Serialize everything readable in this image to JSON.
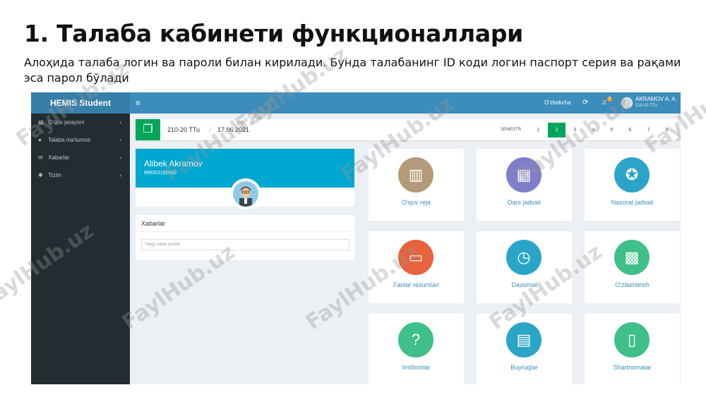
{
  "slide": {
    "title": "1. Талаба кабинети функционаллари",
    "subtitle": "Алоҳида талаба логин ва пароли билан кирилади. Бунда талабанинг ID коди логин паспорт серия ва рақами эса парол бўлади"
  },
  "topbar": {
    "logo": "HEMIS Student",
    "menu_glyph": "≡",
    "language": "O'zbekcha",
    "notifications_count": "0",
    "user_name": "AKRAMOV A. A.",
    "user_group": "210-20 TTu"
  },
  "sidebar": {
    "items": [
      {
        "label": "O'quv jarayoni",
        "icon": "book-icon"
      },
      {
        "label": "Talaba ma'lumoti",
        "icon": "user-icon"
      },
      {
        "label": "Xabarlar",
        "icon": "envelope-icon"
      },
      {
        "label": "Tizim",
        "icon": "gear-icon"
      }
    ]
  },
  "semester": {
    "group": "210-20 TTu",
    "separator": "/",
    "date": "17.06.2021",
    "label": "SEMESTR",
    "pages": [
      "1",
      "2",
      "3",
      "4",
      "5",
      "6",
      "7",
      "8"
    ],
    "active_page": "2"
  },
  "profile": {
    "name": "Alibek Akramov",
    "id": "999201100052"
  },
  "news": {
    "title": "Xabarlar",
    "placeholder": "Yangi xabar yozish"
  },
  "tiles": [
    {
      "label": "O'quv reja",
      "icon": "book-open-icon",
      "color": "#b39b7a"
    },
    {
      "label": "Dars jadvali",
      "icon": "calendar-icon",
      "color": "#7f7fc9"
    },
    {
      "label": "Nazorat jadvali",
      "icon": "medal-icon",
      "color": "#2aa5c7"
    },
    {
      "label": "Fanlar resurslari",
      "icon": "monitor-icon",
      "color": "#e6633d"
    },
    {
      "label": "Davomat",
      "icon": "clock-icon",
      "color": "#2aa5c7"
    },
    {
      "label": "O'zlashtirish",
      "icon": "calculator-icon",
      "color": "#3fbf8a"
    },
    {
      "label": "Imtihonlar",
      "icon": "question-icon",
      "color": "#3fbf8a"
    },
    {
      "label": "Buyruqlar",
      "icon": "document-icon",
      "color": "#2aa5c7"
    },
    {
      "label": "Shartnomalar",
      "icon": "contract-icon",
      "color": "#3fbf8a"
    }
  ],
  "watermark": "FaylHub.uz"
}
